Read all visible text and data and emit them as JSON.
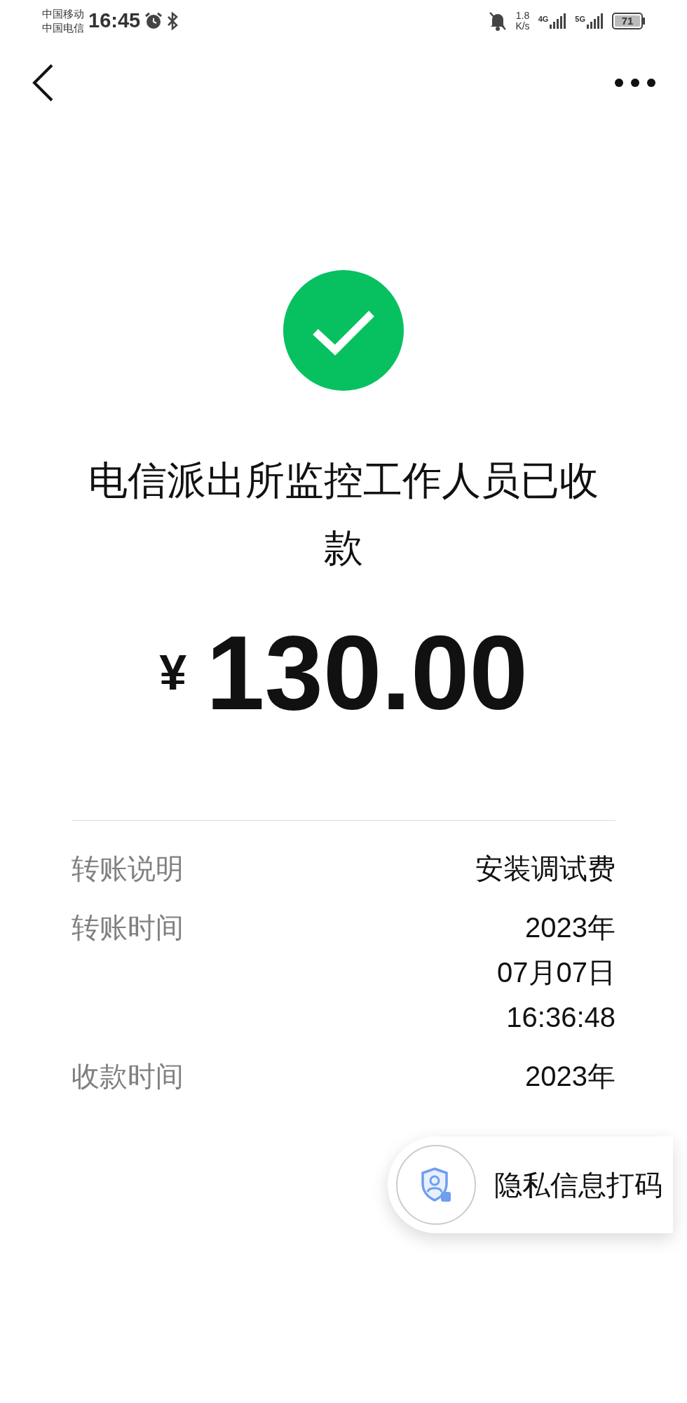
{
  "status_bar": {
    "carriers": [
      "中国移动",
      "中国电信"
    ],
    "time": "16:45",
    "speed_value": "1.8",
    "speed_unit": "K/s",
    "networks": [
      "4G",
      "5G"
    ],
    "battery": "71"
  },
  "payee_title": "电信派出所监控工作人员已收款",
  "amount": {
    "currency": "¥",
    "value": "130.00"
  },
  "details": [
    {
      "label": "转账说明",
      "value_lines": [
        "安装调试费"
      ]
    },
    {
      "label": "转账时间",
      "value_lines": [
        "2023年",
        "07月07日",
        "16:36:48"
      ]
    },
    {
      "label": "收款时间",
      "value_lines": [
        "2023年"
      ]
    }
  ],
  "privacy_button": {
    "label": "隐私信息打码"
  }
}
